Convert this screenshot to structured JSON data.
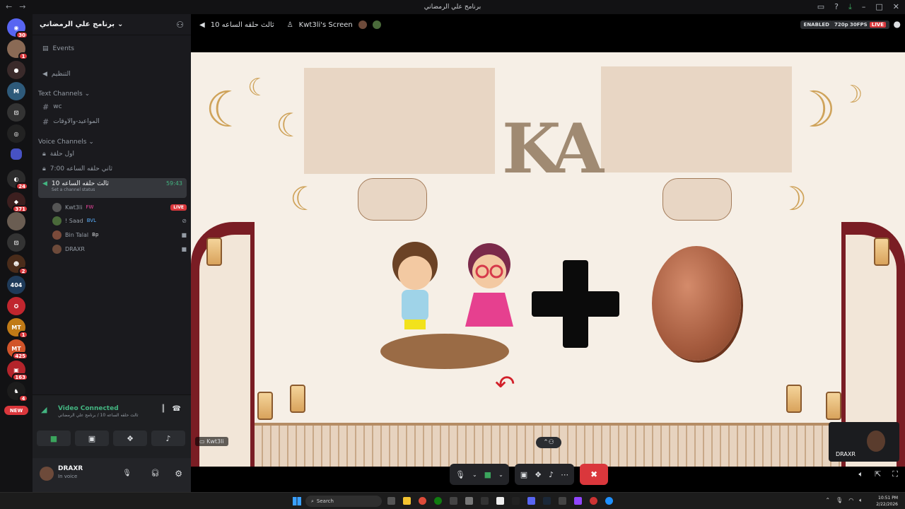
{
  "window": {
    "title": "برنامج علي الرمضاني"
  },
  "server": {
    "name": "برنامج علي الرمضاني"
  },
  "sidebar": {
    "events_label": "Events",
    "channel_organize": "التنظيم",
    "text_category": "Text Channels",
    "text_channels": [
      "wc",
      "المواعيد-والاوقات"
    ],
    "voice_category": "Voice Channels",
    "voice_channels": [
      "اول حلقة",
      "ثاني حلقه الساعه 7:00"
    ],
    "active_channel": {
      "name": "ثالث حلقه الساعه 10",
      "timer": "59:43",
      "status_placeholder": "Set a channel status"
    },
    "members": [
      {
        "name": "Kwt3li",
        "tag": "FW",
        "live": "LIVE"
      },
      {
        "name": "! Saad",
        "tag": "BVL"
      },
      {
        "name": "Bin Talal",
        "tag": "Bp"
      },
      {
        "name": "DRAXR",
        "tag": ""
      }
    ]
  },
  "guild_badges": [
    "30",
    "1",
    "24",
    "371",
    "2",
    "1",
    "425",
    "163",
    "4"
  ],
  "guild_labels": {
    "g404": "404",
    "gmt": "MT",
    "new": "NEW"
  },
  "voice_panel": {
    "title": "Video Connected",
    "subtitle": "ثالث حلقه الساعه 10 / برنامج علي الرمضاني"
  },
  "user_panel": {
    "name": "DRAXR",
    "status": "In voice"
  },
  "stream_header": {
    "channel": "ثالث حلقه الساعه 10",
    "screen_title": "Kwt3li's Screen",
    "enabled": "ENABLED",
    "quality": "720p 30FPS",
    "live": "LIVE"
  },
  "stage": {
    "logo_text": "KA",
    "streamer_tag": "Kwt3li",
    "pip_name": "DRAXR"
  },
  "taskbar": {
    "search_placeholder": "Search",
    "time": "10:51 PM",
    "date": "2/22/2026"
  },
  "colors": {
    "accent": "#5865f2",
    "live": "#da373c",
    "connected": "#43b581"
  }
}
